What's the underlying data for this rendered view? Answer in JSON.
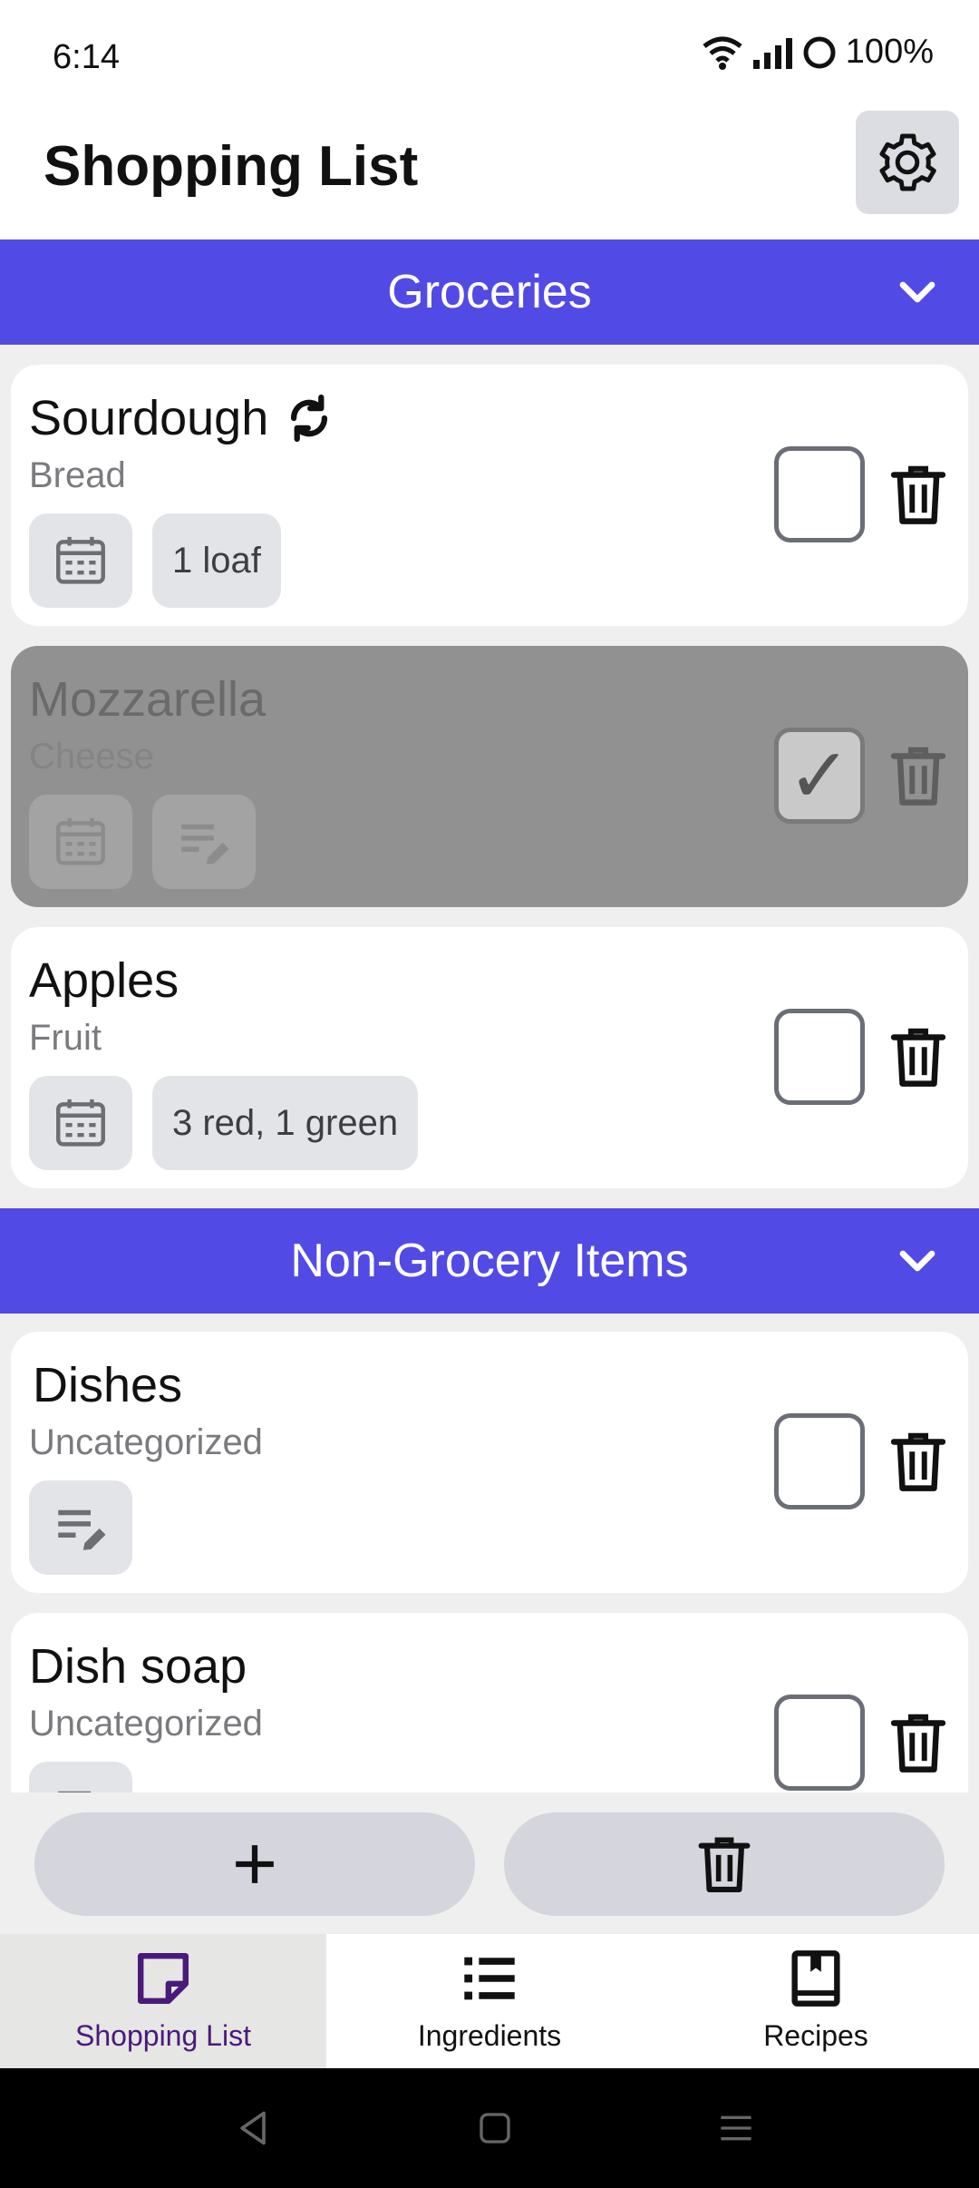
{
  "status": {
    "time": "6:14",
    "battery": "100%"
  },
  "header": {
    "title": "Shopping List",
    "settings_icon": "gear-icon"
  },
  "sections": [
    {
      "title": "Groceries",
      "items": [
        {
          "name": "Sourdough",
          "category": "Bread",
          "recurring": true,
          "note": "1 loaf",
          "checked": false
        },
        {
          "name": "Mozzarella",
          "category": "Cheese",
          "recurring": false,
          "note": "",
          "checked": true
        },
        {
          "name": "Apples",
          "category": "Fruit",
          "recurring": false,
          "note": "3 red, 1 green",
          "checked": false
        }
      ]
    },
    {
      "title": "Non-Grocery Items",
      "items": [
        {
          "name": "Dishes",
          "category": "Uncategorized",
          "note": "",
          "checked": false
        },
        {
          "name": "Dish soap",
          "category": "Uncategorized",
          "note": "",
          "checked": false
        }
      ]
    }
  ],
  "actions": {
    "add_icon": "plus-icon",
    "clear_icon": "trash-icon"
  },
  "nav": [
    {
      "label": "Shopping List",
      "icon": "note-icon",
      "active": true
    },
    {
      "label": "Ingredients",
      "icon": "list-icon",
      "active": false
    },
    {
      "label": "Recipes",
      "icon": "book-icon",
      "active": false
    }
  ],
  "colors": {
    "accent": "#524ae5",
    "checked_card": "#919191",
    "chip": "#e3e4e8",
    "active_nav_text": "#4a1a7a"
  }
}
